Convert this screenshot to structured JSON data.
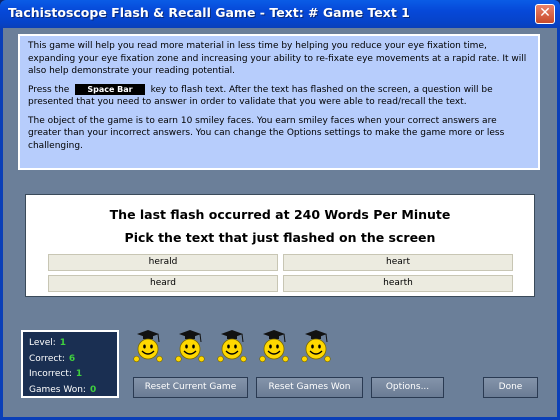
{
  "window": {
    "title": "Tachistoscope Flash & Recall Game - Text: # Game Text 1",
    "close_label": "✕"
  },
  "info": {
    "para1": "This game will help you read more material in less time by helping you reduce your eye fixation time, expanding your eye fixation zone and increasing your ability to re-fixate eye movements at a rapid rate.  It will also help demonstrate your reading potential.",
    "para2_pre": "Press the",
    "key_label": "Space Bar",
    "para2_post": "key to flash text.  After the text has flashed on the screen, a question will be presented that you need to answer in order to validate that you were able to read/recall the text.",
    "para3": "The object of the game is to earn 10 smiley faces.  You earn smiley faces when your correct answers are greater than your incorrect answers.  You can change the Options settings to make the game more or less challenging."
  },
  "game": {
    "speed_line": "The last flash occurred at 240 Words Per Minute",
    "prompt": "Pick the text that just flashed on the screen",
    "answers": [
      "herald",
      "heart",
      "heard",
      "hearth"
    ]
  },
  "stats": {
    "level_label": "Level:",
    "level": "1",
    "correct_label": "Correct:",
    "correct": "6",
    "incorrect_label": "Incorrect:",
    "incorrect": "1",
    "games_won_label": "Games Won:",
    "games_won": "0"
  },
  "smiley_count": 5,
  "buttons": {
    "reset_game": "Reset Current Game",
    "reset_won": "Reset Games Won",
    "options": "Options...",
    "done": "Done"
  },
  "colors": {
    "titlebar": "#0648d8",
    "client_bg": "#6b7f99",
    "info_bg": "#b7cdfc",
    "stats_bg": "#1a2f52",
    "stat_value": "#3fcf3f",
    "smiley": "#ffd800"
  }
}
